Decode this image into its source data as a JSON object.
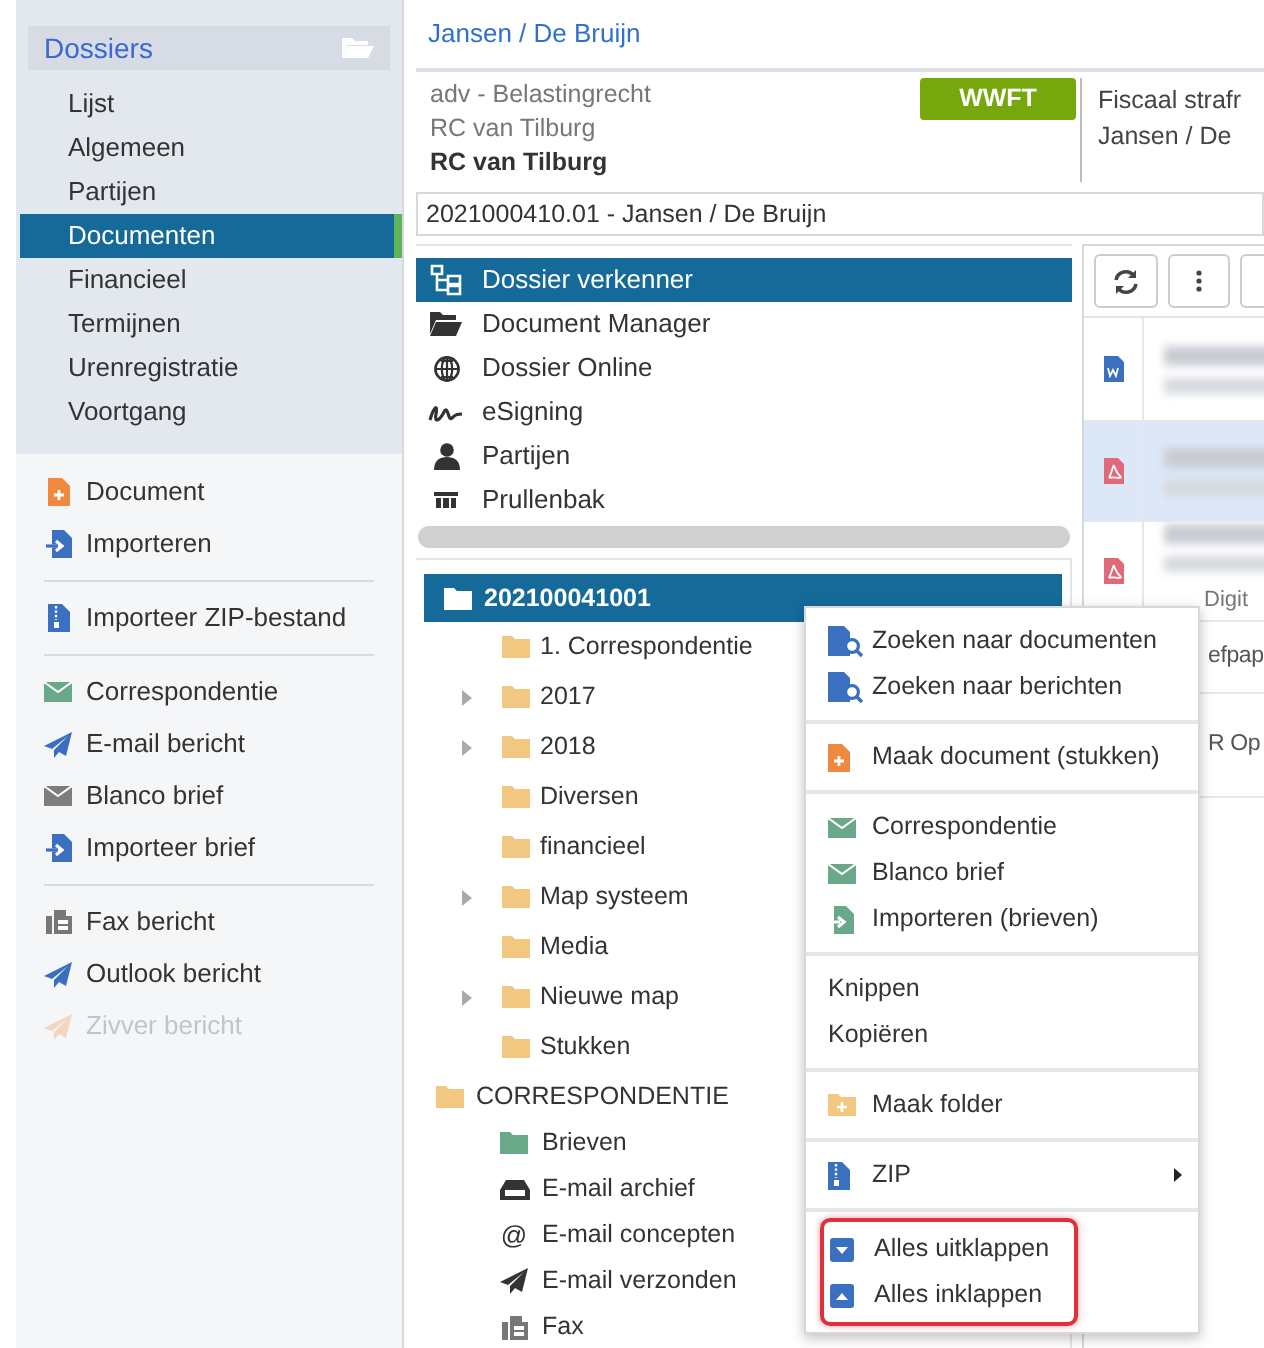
{
  "sidebar": {
    "header": "Dossiers",
    "nav": [
      {
        "label": "Lijst",
        "selected": false
      },
      {
        "label": "Algemeen",
        "selected": false
      },
      {
        "label": "Partijen",
        "selected": false
      },
      {
        "label": "Documenten",
        "selected": true
      },
      {
        "label": "Financieel",
        "selected": false
      },
      {
        "label": "Termijnen",
        "selected": false
      },
      {
        "label": "Urenregistratie",
        "selected": false
      },
      {
        "label": "Voortgang",
        "selected": false
      }
    ],
    "action_groups": [
      [
        {
          "label": "Document",
          "disabled": false
        },
        {
          "label": "Importeren",
          "disabled": false
        }
      ],
      [
        {
          "label": "Importeer ZIP-bestand",
          "disabled": false
        }
      ],
      [
        {
          "label": "Correspondentie",
          "disabled": false
        },
        {
          "label": "E-mail bericht",
          "disabled": false
        },
        {
          "label": "Blanco brief",
          "disabled": false
        },
        {
          "label": "Importeer brief",
          "disabled": false
        }
      ],
      [
        {
          "label": "Fax bericht",
          "disabled": false
        },
        {
          "label": "Outlook bericht",
          "disabled": false
        },
        {
          "label": "Zivver bericht",
          "disabled": true
        }
      ]
    ]
  },
  "breadcrumb": "Jansen / De Bruijn",
  "info": {
    "lines": [
      "adv - Belastingrecht",
      "RC van Tilburg",
      "RC van Tilburg"
    ],
    "badge": "WWFT",
    "right_lines": [
      "Fiscaal strafr",
      "Jansen / De"
    ]
  },
  "dossier_field": {
    "value": "2021000410.01 - Jansen / De Bruijn"
  },
  "explorer_nav": [
    {
      "label": "Dossier verkenner",
      "selected": true
    },
    {
      "label": "Document Manager",
      "selected": false
    },
    {
      "label": "Dossier Online",
      "selected": false
    },
    {
      "label": "eSigning",
      "selected": false
    },
    {
      "label": "Partijen",
      "selected": false
    },
    {
      "label": "Prullenbak",
      "selected": false
    }
  ],
  "tree": [
    {
      "label": "202100041001",
      "selected": true,
      "children": [
        {
          "label": "1. Correspondentie",
          "expandable": false
        },
        {
          "label": "2017",
          "expandable": true
        },
        {
          "label": "2018",
          "expandable": true
        },
        {
          "label": "Diversen",
          "expandable": false
        },
        {
          "label": "financieel",
          "expandable": false
        },
        {
          "label": "Map systeem",
          "expandable": true
        },
        {
          "label": "Media",
          "expandable": false
        },
        {
          "label": "Nieuwe map",
          "expandable": true
        },
        {
          "label": "Stukken",
          "expandable": false
        }
      ]
    },
    {
      "label": "CORRESPONDENTIE",
      "selected": false,
      "children": [
        {
          "label": "Brieven"
        },
        {
          "label": "E-mail archief"
        },
        {
          "label": "E-mail concepten",
          "glyph": "@"
        },
        {
          "label": "E-mail verzonden"
        },
        {
          "label": "Fax"
        }
      ]
    }
  ],
  "documents": {
    "rows": [
      {
        "kind": "word",
        "selected": false
      },
      {
        "kind": "pdf",
        "selected": true
      },
      {
        "kind": "pdf",
        "selected": false,
        "text": "Digit"
      },
      {
        "kind": "none",
        "selected": false,
        "text": "efpap"
      },
      {
        "kind": "none",
        "selected": false,
        "text": "R Op"
      }
    ]
  },
  "context_menu": {
    "sections": [
      {
        "highlighted": false,
        "items": [
          {
            "label": "Zoeken naar documenten"
          },
          {
            "label": "Zoeken naar berichten"
          }
        ]
      },
      {
        "highlighted": false,
        "items": [
          {
            "label": "Maak document (stukken)"
          }
        ]
      },
      {
        "highlighted": false,
        "items": [
          {
            "label": "Correspondentie"
          },
          {
            "label": "Blanco brief"
          },
          {
            "label": "Importeren (brieven)"
          }
        ]
      },
      {
        "highlighted": false,
        "items": [
          {
            "label": "Knippen"
          },
          {
            "label": "Kopiëren"
          }
        ]
      },
      {
        "highlighted": false,
        "items": [
          {
            "label": "Maak folder"
          }
        ]
      },
      {
        "highlighted": false,
        "items": [
          {
            "label": "ZIP",
            "submenu": true
          }
        ]
      },
      {
        "highlighted": true,
        "items": [
          {
            "label": "Alles uitklappen"
          },
          {
            "label": "Alles inklappen"
          }
        ]
      }
    ]
  }
}
